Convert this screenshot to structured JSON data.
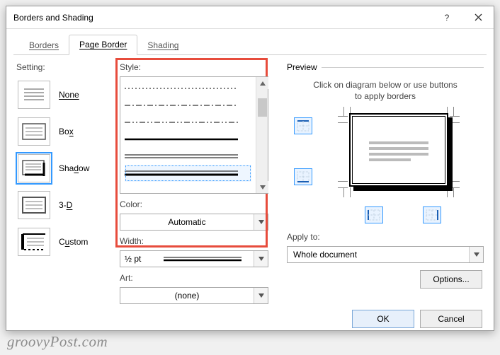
{
  "title": "Borders and Shading",
  "tabs": {
    "borders": "Borders",
    "page_border": "Page Border",
    "shading": "Shading"
  },
  "setting": {
    "label": "Setting:",
    "none": "None",
    "box": "Box",
    "shadow": "Shadow",
    "threed": "3-D",
    "custom": "Custom"
  },
  "style_label": "Style:",
  "color": {
    "label": "Color:",
    "value": "Automatic"
  },
  "width": {
    "label": "Width:",
    "value": "½ pt"
  },
  "art": {
    "label": "Art:",
    "value": "(none)"
  },
  "preview": {
    "label": "Preview",
    "instruction_l1": "Click on diagram below or use buttons",
    "instruction_l2": "to apply borders"
  },
  "apply": {
    "label": "Apply to:",
    "value": "Whole document"
  },
  "buttons": {
    "options": "Options...",
    "ok": "OK",
    "cancel": "Cancel"
  },
  "watermark": "groovyPost.com"
}
